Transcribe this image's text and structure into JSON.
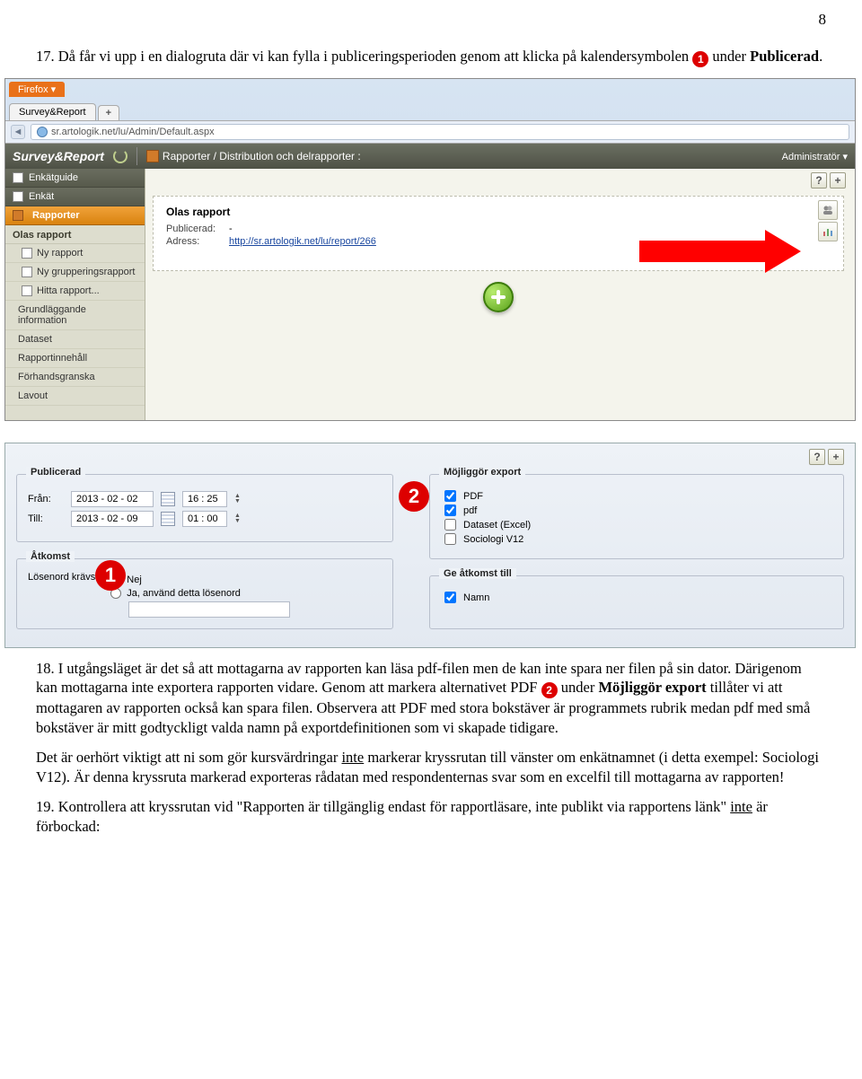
{
  "page_number": "8",
  "intro_text_pre": "17. Då får vi upp i en dialogruta där vi kan fylla i publiceringsperioden genom att klicka på kalendersymbolen ",
  "intro_bullet": "1",
  "intro_text_post": " under ",
  "intro_bold": "Publicerad",
  "intro_end": ".",
  "browser": {
    "firefox_label": "Firefox ▾",
    "tab_title": "Survey&Report",
    "tab_plus": "+",
    "url": "sr.artologik.net/lu/Admin/Default.aspx",
    "app_name": "Survey&Report",
    "breadcrumb": "Rapporter / Distribution och delrapporter :",
    "admin": "Administratör ▾"
  },
  "sidebar": {
    "enkatguide": "Enkätguide",
    "enkat": "Enkät",
    "rapporter": "Rapporter",
    "current_report": "Olas rapport",
    "items": [
      "Ny rapport",
      "Ny grupperingsrapport",
      "Hitta rapport..."
    ],
    "sub": [
      "Grundläggande information",
      "Dataset",
      "Rapportinnehåll",
      "Förhandsgranska",
      "Lavout"
    ]
  },
  "report_card": {
    "title": "Olas rapport",
    "published_label": "Publicerad:",
    "published_value": "-",
    "address_label": "Adress:",
    "address_url": "http://sr.artologik.net/lu/report/266"
  },
  "panel": {
    "publicerad": {
      "legend": "Publicerad",
      "from_label": "Från:",
      "from_date": "2013 - 02 - 02",
      "from_time": "16 : 25",
      "till_label": "Till:",
      "till_date": "2013 - 02 - 09",
      "till_time": "01 : 00"
    },
    "export": {
      "legend": "Möjliggör export",
      "opts": [
        "PDF",
        "pdf",
        "Dataset (Excel)",
        "Sociologi V12"
      ],
      "checked": [
        true,
        true,
        false,
        false
      ]
    },
    "atkomst": {
      "legend": "Åtkomst",
      "pw_label": "Lösenord krävs:",
      "nej": "Nej",
      "ja": "Ja, använd detta lösenord"
    },
    "give": {
      "legend": "Ge åtkomst till",
      "namn": "Namn"
    }
  },
  "para18a": "18. I utgångsläget är det så att mottagarna av rapporten kan läsa pdf-filen men de kan inte spara ner filen på sin dator. Därigenom kan mottagarna inte exportera rapporten vidare. Genom att markera alternativet PDF ",
  "para18_bullet": "2",
  "para18b": " under ",
  "para18_bold": "Möjliggör export",
  "para18c": " tillåter vi att mottagaren av rapporten också kan spara filen. Observera att PDF med stora bokstäver är programmets rubrik medan pdf med små bokstäver är mitt godtyckligt valda namn på exportdefinitionen som vi skapade tidigare.",
  "para_warn_a": "Det är oerhört viktigt att ni som gör kursvärdringar ",
  "para_warn_u1": "inte",
  "para_warn_b": " markerar kryssrutan till vänster om enkätnamnet (i detta exempel: Sociologi V12). Är denna kryssruta markerad exporteras rådatan med respondenternas svar som en excelfil till mottagarna av rapporten!",
  "para19a": "19. Kontrollera att kryssrutan vid \"Rapporten är tillgänglig endast för rapportläsare, inte publikt via rapportens länk\" ",
  "para19_u": "inte",
  "para19b": " är förbockad:"
}
